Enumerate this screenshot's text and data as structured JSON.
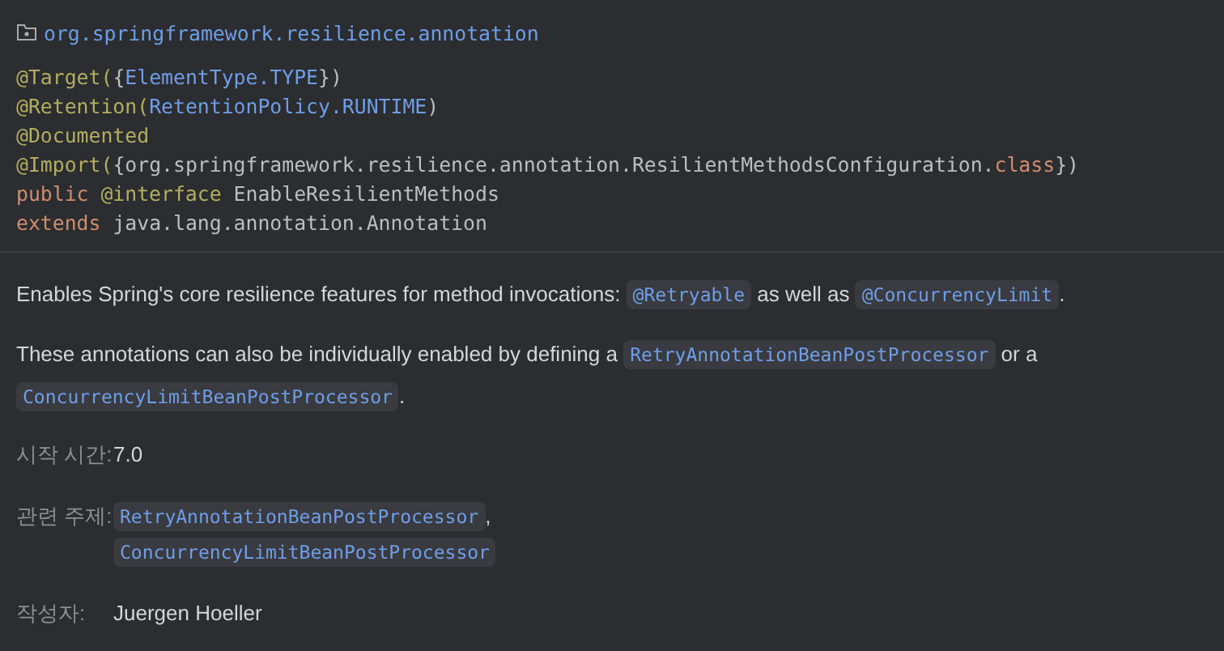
{
  "package": "org.springframework.resilience.annotation",
  "code_lines": [
    [
      {
        "kind": "annotation",
        "text": "@Target("
      },
      {
        "kind": "plain",
        "text": "{"
      },
      {
        "kind": "type",
        "text": "ElementType.TYPE"
      },
      {
        "kind": "plain",
        "text": "})"
      }
    ],
    [
      {
        "kind": "annotation",
        "text": "@Retention("
      },
      {
        "kind": "type",
        "text": "RetentionPolicy.RUNTIME"
      },
      {
        "kind": "plain",
        "text": ")"
      }
    ],
    [
      {
        "kind": "annotation",
        "text": "@Documented"
      }
    ],
    [
      {
        "kind": "annotation",
        "text": "@Import("
      },
      {
        "kind": "plain",
        "text": "{org.springframework.resilience.annotation.ResilientMethodsConfiguration."
      },
      {
        "kind": "keyword",
        "text": "class"
      },
      {
        "kind": "plain",
        "text": "})"
      }
    ],
    [
      {
        "kind": "keyword",
        "text": "public "
      },
      {
        "kind": "annotation",
        "text": "@interface"
      },
      {
        "kind": "plain",
        "text": " EnableResilientMethods"
      }
    ],
    [
      {
        "kind": "keyword",
        "text": "extends "
      },
      {
        "kind": "plain",
        "text": "java.lang.annotation.Annotation"
      }
    ]
  ],
  "paragraphs": [
    [
      {
        "kind": "text",
        "text": "Enables Spring's core resilience features for method invocations: "
      },
      {
        "kind": "code",
        "text": "@Retryable"
      },
      {
        "kind": "text",
        "text": " as well as "
      },
      {
        "kind": "code",
        "text": "@ConcurrencyLimit"
      },
      {
        "kind": "text",
        "text": "."
      }
    ],
    [
      {
        "kind": "text",
        "text": "These annotations can also be individually enabled by defining a "
      },
      {
        "kind": "code",
        "text": "RetryAnnotationBeanPostProcessor"
      },
      {
        "kind": "text",
        "text": " or a "
      },
      {
        "kind": "code",
        "text": "ConcurrencyLimitBeanPostProcessor"
      },
      {
        "kind": "text",
        "text": "."
      }
    ]
  ],
  "metadata": [
    {
      "label": "시작 시간:",
      "lines": [
        [
          {
            "kind": "text",
            "text": "7.0"
          }
        ]
      ]
    },
    {
      "label": "관련 주제:",
      "lines": [
        [
          {
            "kind": "code",
            "text": "RetryAnnotationBeanPostProcessor"
          },
          {
            "kind": "text",
            "text": ","
          }
        ],
        [
          {
            "kind": "code",
            "text": "ConcurrencyLimitBeanPostProcessor"
          }
        ]
      ]
    },
    {
      "label": "작성자:",
      "lines": [
        [
          {
            "kind": "text",
            "text": "Juergen Hoeller"
          }
        ]
      ]
    }
  ]
}
